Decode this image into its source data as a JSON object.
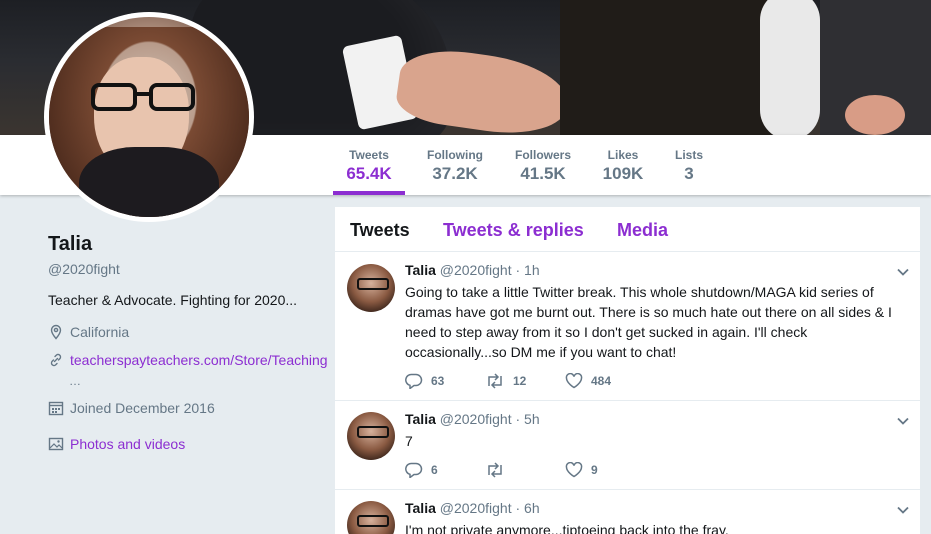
{
  "profile": {
    "name": "Talia",
    "handle": "@2020fight",
    "bio": "Teacher & Advocate. Fighting for 2020...",
    "location": "California",
    "website": "teacherspayteachers.com/Store/Teaching",
    "website_more": "…",
    "joined": "Joined December 2016",
    "photos_link": "Photos and videos"
  },
  "stats": [
    {
      "label": "Tweets",
      "value": "65.4K",
      "active": true
    },
    {
      "label": "Following",
      "value": "37.2K",
      "active": false
    },
    {
      "label": "Followers",
      "value": "41.5K",
      "active": false
    },
    {
      "label": "Likes",
      "value": "109K",
      "active": false
    },
    {
      "label": "Lists",
      "value": "3",
      "active": false
    }
  ],
  "tabs": [
    {
      "label": "Tweets",
      "active": true
    },
    {
      "label": "Tweets & replies",
      "active": false
    },
    {
      "label": "Media",
      "active": false
    }
  ],
  "tweets": [
    {
      "name": "Talia",
      "handle": "@2020fight",
      "sep": "·",
      "time": "1h",
      "text": "Going to take a little Twitter break. This whole shutdown/MAGA kid series of dramas have got me burnt out. There is so much hate out there on all sides & I need to step away from it so I don't get sucked in again. I'll check occasionally...so DM me if you want to chat!",
      "replies": "63",
      "retweets": "12",
      "likes": "484"
    },
    {
      "name": "Talia",
      "handle": "@2020fight",
      "sep": "·",
      "time": "5h",
      "text": "7",
      "replies": "6",
      "retweets": "",
      "likes": "9"
    },
    {
      "name": "Talia",
      "handle": "@2020fight",
      "sep": "·",
      "time": "6h",
      "text": "I'm not private anymore...tiptoeing back into the fray.",
      "replies": "",
      "retweets": "",
      "likes": ""
    }
  ],
  "colors": {
    "accent": "#8c2ed1",
    "muted": "#657786",
    "text": "#14171a",
    "background": "#e6ecf0"
  },
  "icons": {
    "location": "location-pin-icon",
    "link": "link-icon",
    "calendar": "calendar-icon",
    "photos": "image-icon",
    "reply": "reply-icon",
    "retweet": "retweet-icon",
    "like": "heart-icon",
    "caret": "chevron-down-icon"
  }
}
